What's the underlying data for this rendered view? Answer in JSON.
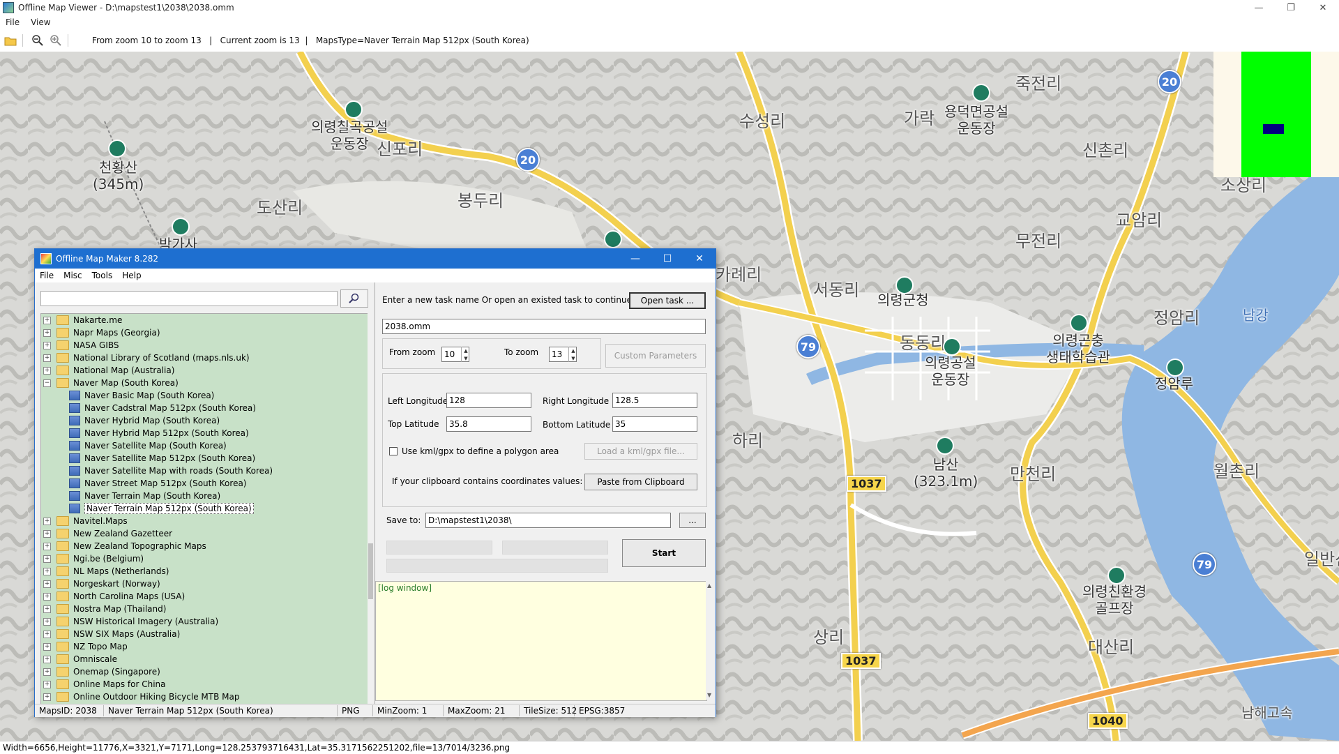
{
  "viewer": {
    "title": "Offline Map Viewer - D:\\mapstest1\\2038\\2038.omm",
    "menu": [
      "File",
      "View"
    ],
    "toolbar_info": "From zoom 10 to zoom 13   |   Current zoom is 13  |   MapsType=Naver Terrain Map 512px (South Korea)",
    "status": "Width=6656,Height=11776,X=3321,Y=7171,Long=128.253793716431,Lat=35.3171562251202,file=13/7014/3236.png"
  },
  "map": {
    "labels": [
      "천황산\n(345m)",
      "도산리",
      "봉두리",
      "의령칠곡공설\n운동장",
      "신포리",
      "수성리",
      "가락",
      "용덕면공설\n운동장",
      "죽전리",
      "신촌리",
      "교암리",
      "소상리",
      "무전리",
      "서동리",
      "의령군청",
      "동동리",
      "의령곤충\n생태학습관",
      "정암리",
      "정암루",
      "남강",
      "의령공설\n운동장",
      "하리",
      "남산\n(323.1m)",
      "만천리",
      "월촌리",
      "의령친환경\n골프장",
      "상리",
      "대산리",
      "박가사",
      "남해고속",
      "일반산",
      "카례리"
    ],
    "shields": [
      "20",
      "20",
      "79",
      "79"
    ],
    "routes": [
      "1037",
      "1037",
      "1040"
    ]
  },
  "dialog": {
    "title": "Offline Map Maker 8.282",
    "menu": [
      "File",
      "Misc",
      "Tools",
      "Help"
    ],
    "search_value": "",
    "tree": [
      {
        "label": "Nakarte.me",
        "level": 0,
        "expanded": false
      },
      {
        "label": "Napr Maps (Georgia)",
        "level": 0,
        "expanded": false
      },
      {
        "label": "NASA GIBS",
        "level": 0,
        "expanded": false
      },
      {
        "label": "National Library of Scotland (maps.nls.uk)",
        "level": 0,
        "expanded": false
      },
      {
        "label": "National Map (Australia)",
        "level": 0,
        "expanded": false
      },
      {
        "label": "Naver Map (South Korea)",
        "level": 0,
        "expanded": true
      },
      {
        "label": "Naver Basic Map (South Korea)",
        "level": 1
      },
      {
        "label": "Naver Cadstral Map 512px (South Korea)",
        "level": 1
      },
      {
        "label": "Naver Hybrid Map (South Korea)",
        "level": 1
      },
      {
        "label": "Naver Hybrid Map 512px (South Korea)",
        "level": 1
      },
      {
        "label": "Naver Satellite Map (South Korea)",
        "level": 1
      },
      {
        "label": "Naver Satellite Map 512px (South Korea)",
        "level": 1
      },
      {
        "label": "Naver Satellite Map with roads (South Korea)",
        "level": 1
      },
      {
        "label": "Naver Street Map 512px (South Korea)",
        "level": 1
      },
      {
        "label": "Naver Terrain Map (South Korea)",
        "level": 1
      },
      {
        "label": "Naver Terrain Map 512px (South Korea)",
        "level": 1,
        "selected": true
      },
      {
        "label": "Navitel.Maps",
        "level": 0,
        "expanded": false
      },
      {
        "label": "New Zealand Gazetteer",
        "level": 0,
        "expanded": false
      },
      {
        "label": "New Zealand Topographic Maps",
        "level": 0,
        "expanded": false
      },
      {
        "label": "Ngi.be (Belgium)",
        "level": 0,
        "expanded": false
      },
      {
        "label": "NL Maps (Netherlands)",
        "level": 0,
        "expanded": false
      },
      {
        "label": "Norgeskart (Norway)",
        "level": 0,
        "expanded": false
      },
      {
        "label": "North Carolina Maps (USA)",
        "level": 0,
        "expanded": false
      },
      {
        "label": "Nostra Map (Thailand)",
        "level": 0,
        "expanded": false
      },
      {
        "label": "NSW Historical Imagery (Australia)",
        "level": 0,
        "expanded": false
      },
      {
        "label": "NSW SIX Maps (Australia)",
        "level": 0,
        "expanded": false
      },
      {
        "label": "NZ Topo Map",
        "level": 0,
        "expanded": false
      },
      {
        "label": "Omniscale",
        "level": 0,
        "expanded": false
      },
      {
        "label": "Onemap (Singapore)",
        "level": 0,
        "expanded": false
      },
      {
        "label": "Online Maps for China",
        "level": 0,
        "expanded": false
      },
      {
        "label": "Online Outdoor Hiking Bicycle MTB Map",
        "level": 0,
        "expanded": false
      }
    ],
    "task_prompt": "Enter a new task name Or open an existed task to continue:",
    "open_task_label": "Open task ...",
    "task_name": "2038.omm",
    "from_zoom_label": "From zoom",
    "from_zoom": "10",
    "to_zoom_label": "To zoom",
    "to_zoom": "13",
    "custom_params_label": "Custom Parameters",
    "left_lon_label": "Left Longitude",
    "left_lon": "128",
    "right_lon_label": "Right Longitude",
    "right_lon": "128.5",
    "top_lat_label": "Top Latitude",
    "top_lat": "35.8",
    "bottom_lat_label": "Bottom Latitude",
    "bottom_lat": "35",
    "kml_label": "Use kml/gpx to define a polygon area",
    "load_kml_label": "Load a kml/gpx file...",
    "clipboard_label": "If your clipboard contains coordinates values:",
    "paste_label": "Paste from Clipboard",
    "save_to_label": "Save to:",
    "save_to": "D:\\mapstest1\\2038\\",
    "browse_label": "...",
    "start_label": "Start",
    "log_text": "[log window]",
    "status": {
      "maps_id": "MapsID: 2038",
      "map_name": "Naver Terrain Map 512px (South Korea)",
      "format": "PNG",
      "min_zoom": "MinZoom: 1",
      "max_zoom": "MaxZoom: 21",
      "tile_size": "TileSize: 512",
      "epsg": "EPSG:3857"
    }
  }
}
